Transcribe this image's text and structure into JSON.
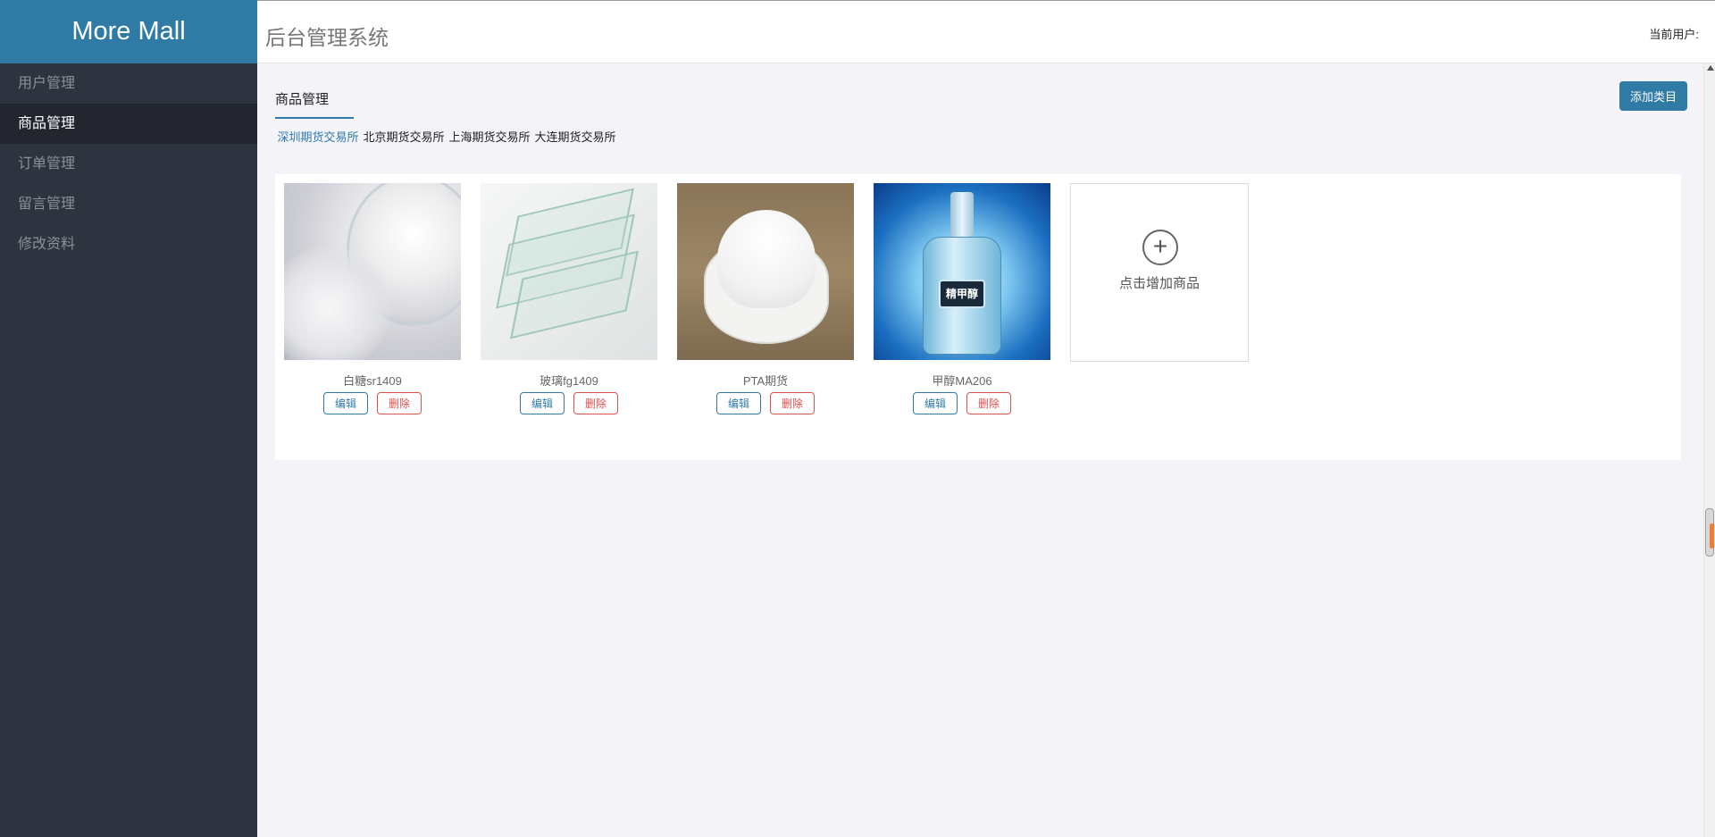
{
  "sidebar": {
    "logo": "More Mall",
    "items": [
      {
        "label": "用户管理"
      },
      {
        "label": "商品管理"
      },
      {
        "label": "订单管理"
      },
      {
        "label": "留言管理"
      },
      {
        "label": "修改资料"
      }
    ]
  },
  "header": {
    "title": "后台管理系统",
    "user_label": "当前用户:"
  },
  "main": {
    "section_tab": "商品管理",
    "add_category_label": "添加类目",
    "sub_tabs": [
      {
        "label": "深圳期货交易所"
      },
      {
        "label": "北京期货交易所"
      },
      {
        "label": "上海期货交易所"
      },
      {
        "label": "大连期货交易所"
      }
    ],
    "products": [
      {
        "name": "白糖sr1409"
      },
      {
        "name": "玻璃fg1409"
      },
      {
        "name": "PTA期货"
      },
      {
        "name": "甲醇MA206",
        "image_text": "精甲醇"
      }
    ],
    "edit_label": "编辑",
    "delete_label": "删除",
    "add_product_label": "点击增加商品",
    "plus_glyph": "+"
  },
  "colors": {
    "accent": "#2f7ba6",
    "sidebar_bg": "#2e3340",
    "danger": "#d9534f"
  }
}
